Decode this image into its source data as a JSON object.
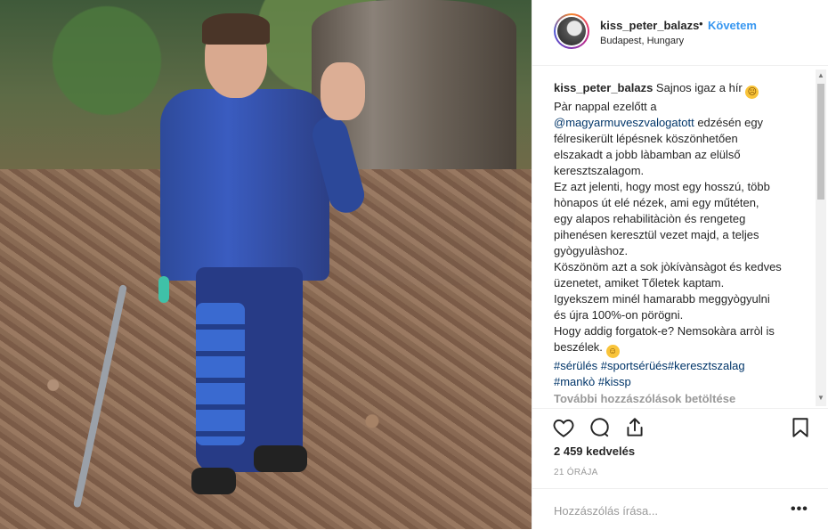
{
  "post": {
    "username": "kiss_peter_balazs",
    "dot": "•",
    "follow_label": "Követem",
    "location": "Budapest, Hungary"
  },
  "caption": {
    "username": "kiss_peter_balazs",
    "lines": [
      "Sajnos igaz a hír",
      "Pàr nappal ezelőtt a",
      "@magyarmuveszvalogatott edzésén egy",
      "félresikerült lépésnek köszönhetően",
      "elszakadt a jobb làbamban az elülső",
      "keresztszalagom.",
      "Ez azt jelenti, hogy most egy hosszú, több",
      "hònapos út elé nézek, ami egy műtéten,",
      "egy alapos rehabilitàciòn és rengeteg",
      "pihenésen keresztül vezet majd, a teljes",
      "gyògyulàshoz.",
      "Köszönöm azt a sok jòkívànsàgot és kedves",
      "üzenetet, amiket Tőletek kaptam.",
      "Igyekszem minél hamarabb meggyògyulni",
      "és újra 100%-on pörögni.",
      "Hogy addig forgatok-e? Nemsokàra arròl is",
      "beszélek."
    ],
    "hashtags_line1": "#sérülés #sportsérüés#keresztszalag",
    "hashtags_line2": "#mankò #kissp",
    "mention": "@magyarmuveszvalogatott"
  },
  "load_more": "További hozzászólások betöltése",
  "likes": "2 459 kedvelés",
  "time": "21 ÓRÁJA",
  "comment_placeholder": "Hozzászólás írása...",
  "more_options": "•••",
  "icons": {
    "like": "heart-icon",
    "comment": "comment-icon",
    "share": "share-icon",
    "save": "bookmark-icon"
  },
  "colors": {
    "follow_blue": "#3897f0",
    "hashtag": "#003569",
    "muted": "#999999"
  }
}
